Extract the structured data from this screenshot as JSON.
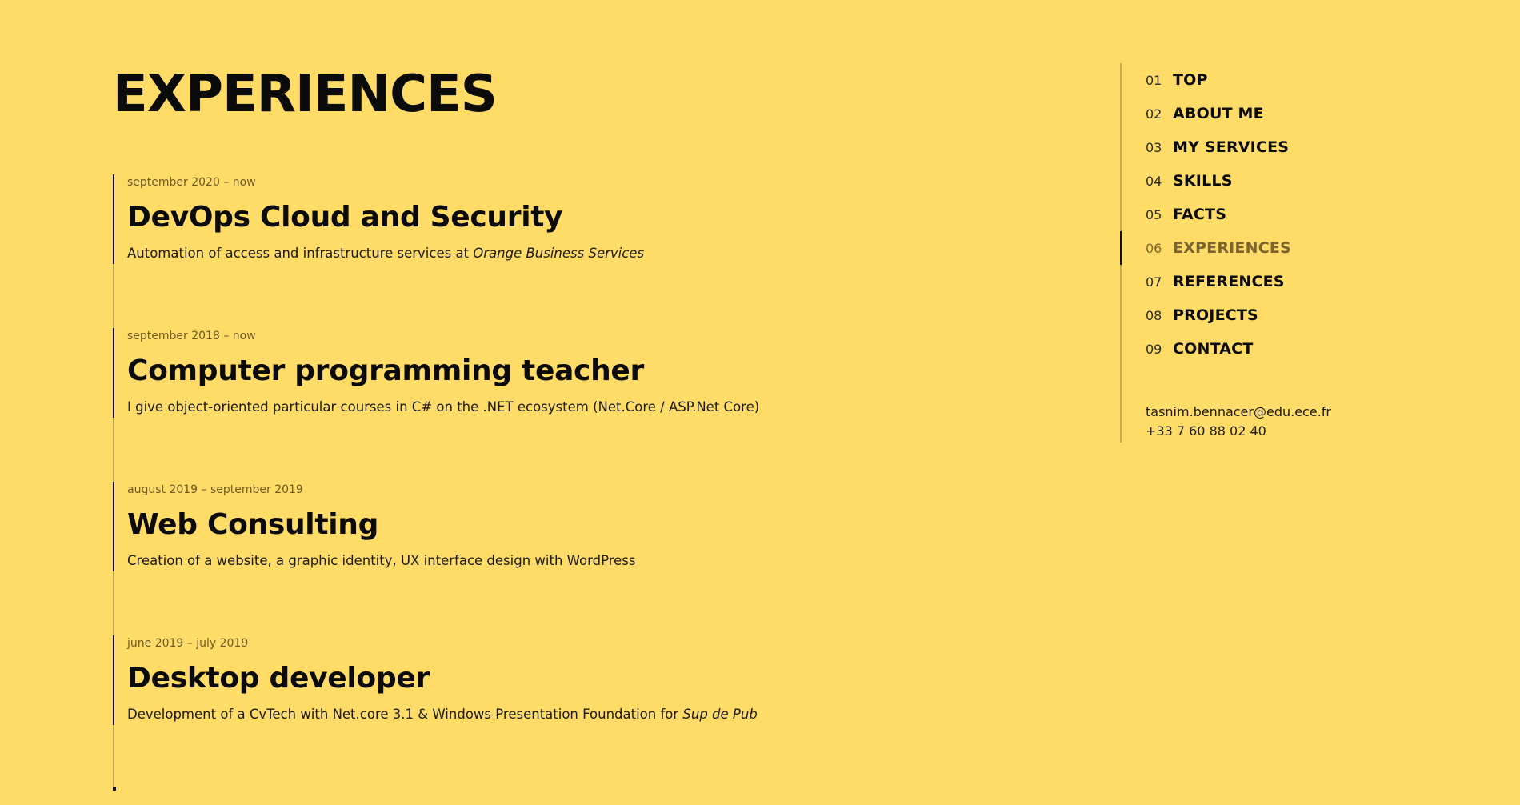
{
  "page": {
    "title": "EXPERIENCES",
    "background_color": "#FFDC67",
    "text_color": "#0b0b0b",
    "active_nav_color": "#7a6530"
  },
  "experiences": [
    {
      "date": "september 2020 – now",
      "title": "DevOps Cloud and Security",
      "description": "Automation of access and infrastructure services at ",
      "description_em": "Orange Business Services"
    },
    {
      "date": "september 2018 – now",
      "title": "Computer programming teacher",
      "description": "I give object-oriented particular courses in C# on the .NET ecosystem (Net.Core / ASP.Net Core)",
      "description_em": ""
    },
    {
      "date": "august 2019 – september 2019",
      "title": "Web Consulting",
      "description": "Creation of a website, a graphic identity, UX interface design with WordPress",
      "description_em": ""
    },
    {
      "date": "june 2019 – july 2019",
      "title": "Desktop developer",
      "description": "Development of a CvTech with Net.core 3.1 & Windows Presentation Foundation for ",
      "description_em": "Sup de Pub"
    }
  ],
  "nav": {
    "active_index": 5,
    "items": [
      {
        "num": "01",
        "label": "TOP"
      },
      {
        "num": "02",
        "label": "ABOUT ME"
      },
      {
        "num": "03",
        "label": "MY SERVICES"
      },
      {
        "num": "04",
        "label": "SKILLS"
      },
      {
        "num": "05",
        "label": "FACTS"
      },
      {
        "num": "06",
        "label": "EXPERIENCES"
      },
      {
        "num": "07",
        "label": "REFERENCES"
      },
      {
        "num": "08",
        "label": "PROJECTS"
      },
      {
        "num": "09",
        "label": "CONTACT"
      }
    ]
  },
  "contact": {
    "email": "tasnim.bennacer@edu.ece.fr",
    "phone": "+33 7 60 88 02 40"
  }
}
